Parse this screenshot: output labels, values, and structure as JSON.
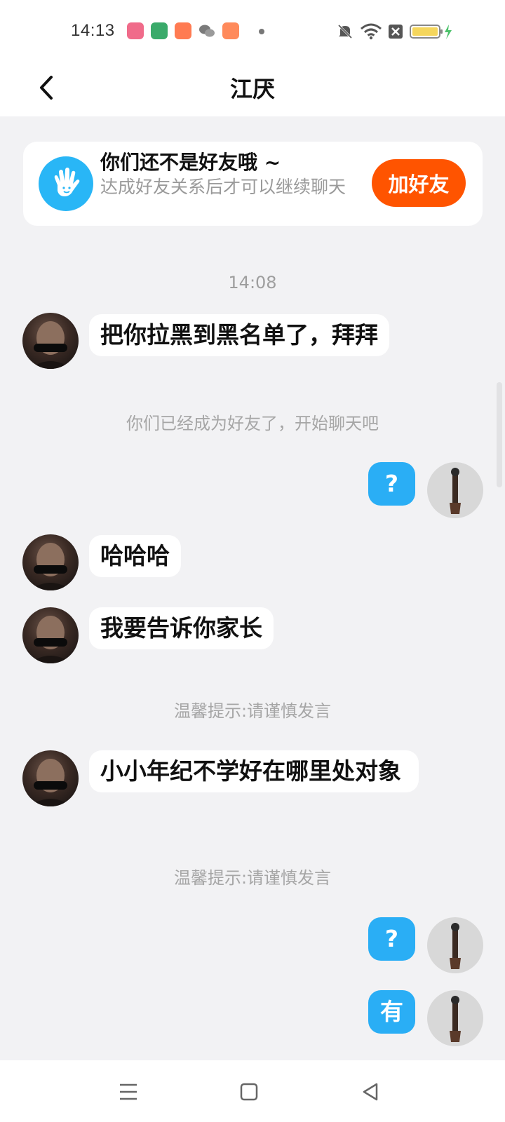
{
  "status": {
    "time": "14:13",
    "app_icons": [
      {
        "name": "camera-app-icon",
        "color": "#f06b8a"
      },
      {
        "name": "oppo-app-icon",
        "color": "#3aaa6a"
      },
      {
        "name": "video-app-icon",
        "color": "#ff7b52"
      },
      {
        "name": "wechat-app-icon",
        "color": "#7a7a7a"
      },
      {
        "name": "grid-app-icon",
        "color": "#ff8a5b"
      }
    ]
  },
  "header": {
    "title": "江厌"
  },
  "banner": {
    "title": "你们还不是好友哦 ~",
    "subtitle": "达成好友关系后才可以继续聊天",
    "button": "加好友"
  },
  "chat": {
    "timestamp": "14:08",
    "messages": [
      {
        "side": "left",
        "text": "把你拉黑到黑名单了，拜拜"
      },
      {
        "side": "system",
        "text": "你们已经成为好友了，开始聊天吧"
      },
      {
        "side": "right",
        "text": "?"
      },
      {
        "side": "left",
        "text": "哈哈哈"
      },
      {
        "side": "left",
        "text": "我要告诉你家长"
      },
      {
        "side": "system",
        "text": "温馨提示:请谨慎发言"
      },
      {
        "side": "left",
        "text": "小小年纪不学好在哪里处对象"
      },
      {
        "side": "system",
        "text": "温馨提示:请谨慎发言"
      },
      {
        "side": "right",
        "text": "?"
      },
      {
        "side": "right",
        "text": "有"
      }
    ]
  },
  "colors": {
    "accent_orange": "#ff5400",
    "bubble_blue": "#2aaef5",
    "icon_blue": "#29b6f6"
  }
}
